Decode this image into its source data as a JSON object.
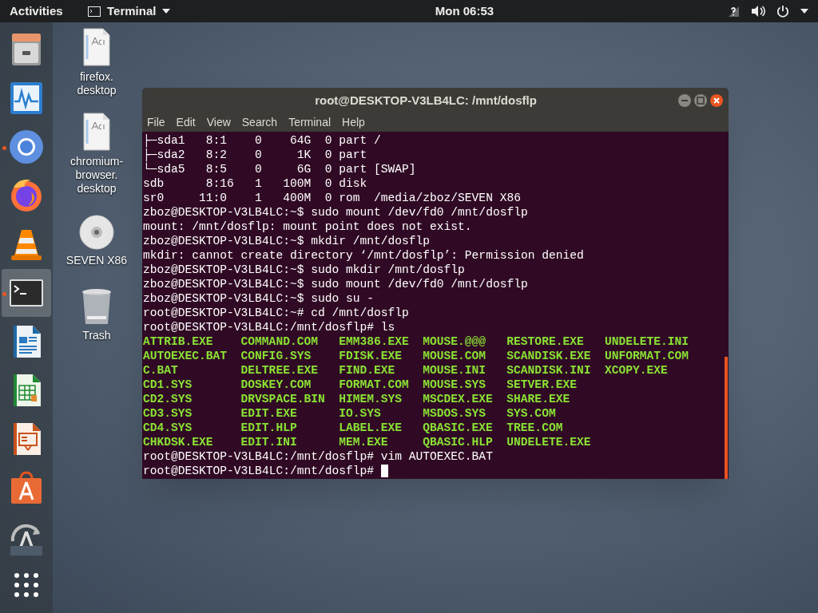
{
  "top_bar": {
    "activities": "Activities",
    "app_menu": "Terminal",
    "clock": "Mon 06:53"
  },
  "dock": [
    {
      "kind": "files",
      "running": false,
      "selected": false
    },
    {
      "kind": "monitor",
      "running": false,
      "selected": false
    },
    {
      "kind": "chromium",
      "running": true,
      "selected": false
    },
    {
      "kind": "firefox",
      "running": false,
      "selected": false
    },
    {
      "kind": "vlc",
      "running": false,
      "selected": false
    },
    {
      "kind": "terminal",
      "running": true,
      "selected": true
    },
    {
      "kind": "writer",
      "running": false,
      "selected": false
    },
    {
      "kind": "calc",
      "running": false,
      "selected": false
    },
    {
      "kind": "impress",
      "running": false,
      "selected": false
    },
    {
      "kind": "store",
      "running": false,
      "selected": false
    },
    {
      "kind": "updater",
      "running": false,
      "selected": false
    },
    {
      "kind": "apps",
      "running": false,
      "selected": false
    }
  ],
  "desktop_icons": [
    {
      "kind": "file",
      "label_lines": [
        "firefox.",
        "desktop"
      ]
    },
    {
      "kind": "file",
      "label_lines": [
        "chromium-",
        "browser.",
        "desktop"
      ]
    },
    {
      "kind": "disc",
      "label_lines": [
        "SEVEN X86"
      ]
    },
    {
      "kind": "trash",
      "label_lines": [
        "Trash"
      ]
    }
  ],
  "terminal": {
    "title": "root@DESKTOP-V3LB4LC: /mnt/dosflp",
    "menu": [
      "File",
      "Edit",
      "View",
      "Search",
      "Terminal",
      "Help"
    ],
    "lines_before": [
      "├─sda1   8:1    0    64G  0 part /",
      "├─sda2   8:2    0     1K  0 part",
      "└─sda5   8:5    0     6G  0 part [SWAP]",
      "sdb      8:16   1   100M  0 disk",
      "sr0     11:0    1   400M  0 rom  /media/zboz/SEVEN X86",
      "zboz@DESKTOP-V3LB4LC:~$ sudo mount /dev/fd0 /mnt/dosflp",
      "mount: /mnt/dosflp: mount point does not exist.",
      "zboz@DESKTOP-V3LB4LC:~$ mkdir /mnt/dosflp",
      "mkdir: cannot create directory ‘/mnt/dosflp’: Permission denied",
      "zboz@DESKTOP-V3LB4LC:~$ sudo mkdir /mnt/dosflp",
      "zboz@DESKTOP-V3LB4LC:~$ sudo mount /dev/fd0 /mnt/dosflp",
      "zboz@DESKTOP-V3LB4LC:~$ sudo su -",
      "root@DESKTOP-V3LB4LC:~# cd /mnt/dosflp",
      "root@DESKTOP-V3LB4LC:/mnt/dosflp# ls"
    ],
    "files": [
      [
        "ATTRIB.EXE",
        "COMMAND.COM",
        "EMM386.EXE",
        "MOUSE.@@@",
        "RESTORE.EXE",
        "UNDELETE.INI"
      ],
      [
        "AUTOEXEC.BAT",
        "CONFIG.SYS",
        "FDISK.EXE",
        "MOUSE.COM",
        "SCANDISK.EXE",
        "UNFORMAT.COM"
      ],
      [
        "C.BAT",
        "DELTREE.EXE",
        "FIND.EXE",
        "MOUSE.INI",
        "SCANDISK.INI",
        "XCOPY.EXE"
      ],
      [
        "CD1.SYS",
        "DOSKEY.COM",
        "FORMAT.COM",
        "MOUSE.SYS",
        "SETVER.EXE"
      ],
      [
        "CD2.SYS",
        "DRVSPACE.BIN",
        "HIMEM.SYS",
        "MSCDEX.EXE",
        "SHARE.EXE"
      ],
      [
        "CD3.SYS",
        "EDIT.EXE",
        "IO.SYS",
        "MSDOS.SYS",
        "SYS.COM"
      ],
      [
        "CD4.SYS",
        "EDIT.HLP",
        "LABEL.EXE",
        "QBASIC.EXE",
        "TREE.COM"
      ],
      [
        "CHKDSK.EXE",
        "EDIT.INI",
        "MEM.EXE",
        "QBASIC.HLP",
        "UNDELETE.EXE"
      ]
    ],
    "lines_after": [
      "root@DESKTOP-V3LB4LC:/mnt/dosflp# vim AUTOEXEC.BAT"
    ],
    "prompt": "root@DESKTOP-V3LB4LC:/mnt/dosflp#"
  }
}
